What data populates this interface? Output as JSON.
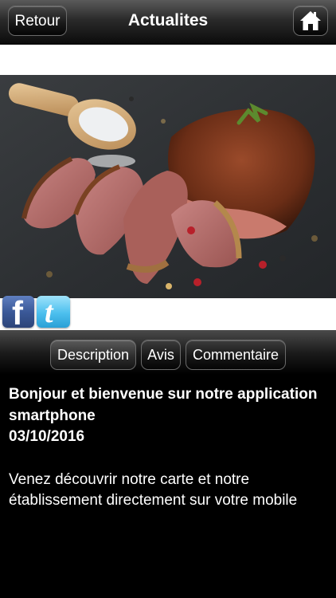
{
  "header": {
    "back_label": "Retour",
    "title": "Actualites",
    "home_icon": "home-icon"
  },
  "hero": {
    "image": "photo-sliced-roast-meat-on-slate-with-salt-scoop"
  },
  "social": {
    "facebook_glyph": "f",
    "twitter_glyph": "t",
    "facebook_icon": "facebook-icon",
    "twitter_icon": "twitter-icon"
  },
  "tabs": [
    {
      "label": "Description",
      "active": true
    },
    {
      "label": "Avis",
      "active": false
    },
    {
      "label": "Commentaire",
      "active": false
    }
  ],
  "article": {
    "headline": "Bonjour et bienvenue sur notre application smartphone",
    "date": "03/10/2016",
    "body": "Venez découvrir notre carte et notre établissement directement sur votre mobile"
  },
  "colors": {
    "bar_dark": "#000000",
    "facebook": "#3b5998",
    "twitter": "#4cbfee"
  }
}
